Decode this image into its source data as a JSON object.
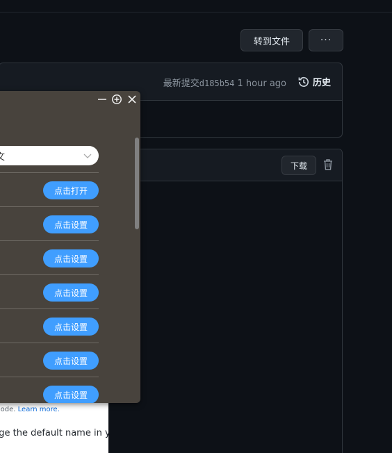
{
  "toolbar": {
    "goto_file_label": "转到文件",
    "more_label": "···"
  },
  "commit": {
    "latest_label": "最新提交",
    "hash": "d185b54",
    "time": "1 hour ago",
    "history_label": "历史"
  },
  "file": {
    "download_label": "下载"
  },
  "background_page": {
    "line1_text": "h your code. ",
    "line1_link": "Learn more.",
    "line2_text": "nge the default name in yo"
  },
  "popup": {
    "controls": [
      "minimize-icon",
      "add-circle-icon",
      "close-icon"
    ],
    "select_value": "文",
    "rows": [
      {
        "button": "点击打开"
      },
      {
        "button": "点击设置"
      },
      {
        "button": "点击设置"
      },
      {
        "button": "点击设置"
      },
      {
        "button": "点击设置"
      },
      {
        "button": "点击设置"
      },
      {
        "button": "点击设置"
      }
    ],
    "accent_color": "#409eff",
    "background_color": "#48433d"
  },
  "colors": {
    "page_bg": "#0d1117",
    "panel_bg": "#161b22",
    "border": "#30363d"
  }
}
